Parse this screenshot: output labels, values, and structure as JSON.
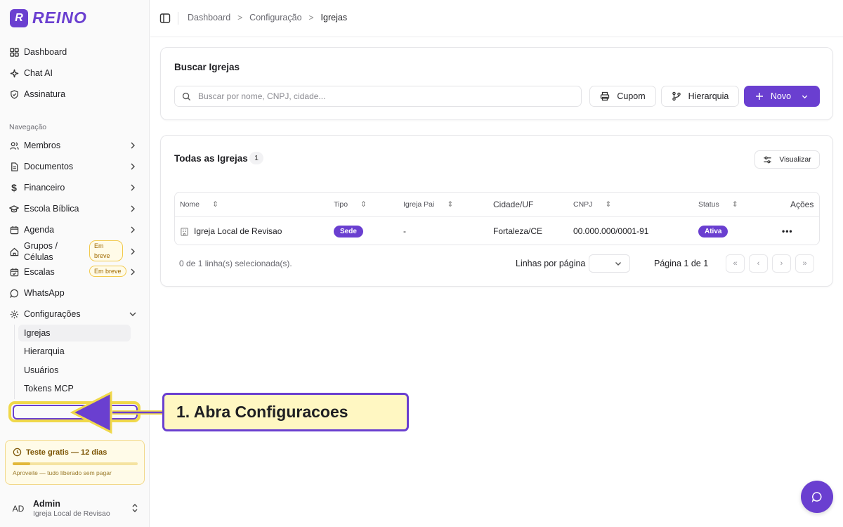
{
  "brand": {
    "name": "REINO"
  },
  "sidebar": {
    "top_items": [
      {
        "label": "Dashboard",
        "icon": "grid-icon"
      },
      {
        "label": "Chat AI",
        "icon": "sparkles-icon"
      },
      {
        "label": "Assinatura",
        "icon": "shield-check-icon"
      }
    ],
    "section_label": "Navegação",
    "nav_items": [
      {
        "label": "Membros",
        "icon": "users-icon"
      },
      {
        "label": "Documentos",
        "icon": "file-icon"
      },
      {
        "label": "Financeiro",
        "icon": "dollar-icon"
      },
      {
        "label": "Escola Bíblica",
        "icon": "graduation-icon"
      },
      {
        "label": "Agenda",
        "icon": "calendar-icon"
      },
      {
        "label_line1": "Grupos /",
        "label_line2": "Células",
        "icon": "home-icon",
        "badge_line1": "Em",
        "badge_line2": "breve"
      },
      {
        "label": "Escalas",
        "icon": "calendar-check-icon",
        "badge": "Em breve"
      },
      {
        "label": "WhatsApp",
        "icon": "message-circle-icon"
      },
      {
        "label": "Configurações",
        "icon": "gear-icon"
      }
    ],
    "sub_items": [
      "Igrejas",
      "Hierarquia",
      "Usuários",
      "Tokens MCP"
    ],
    "trial": {
      "title": "Teste gratis — 12 dias",
      "subtitle": "Aproveite — tudo liberado sem pagar",
      "progress_percent": 14
    },
    "user": {
      "initials": "AD",
      "name": "Admin",
      "org": "Igreja Local de Revisao"
    }
  },
  "header": {
    "breadcrumbs": [
      "Dashboard",
      "Configuração",
      "Igrejas"
    ]
  },
  "search_card": {
    "title": "Buscar Igrejas",
    "placeholder": "Buscar por nome, CNPJ, cidade...",
    "cupom_label": "Cupom",
    "hierarquia_label": "Hierarquia",
    "novo_label": "Novo"
  },
  "list_card": {
    "title": "Todas as Igrejas",
    "count": "1",
    "visualizar_label": "Visualizar",
    "columns": [
      "Nome",
      "Tipo",
      "Igreja Pai",
      "Cidade/UF",
      "CNPJ",
      "Status",
      "Ações"
    ],
    "rows": [
      {
        "nome": "Igreja Local de Revisao",
        "tipo": "Sede",
        "igreja_pai": "-",
        "cidade": "Fortaleza/CE",
        "cnpj": "00.000.000/0001-91",
        "status": "Ativa"
      }
    ],
    "selection_text": "0 de 1 linha(s) selecionada(s).",
    "rows_per_page_label": "Linhas por página",
    "page_info": "Página 1 de 1"
  },
  "annotation": {
    "callout": "1. Abra Configuracoes"
  },
  "colors": {
    "accent": "#6a3fd0",
    "highlight": "#f0d84a",
    "callout_bg": "#fff7c2"
  }
}
